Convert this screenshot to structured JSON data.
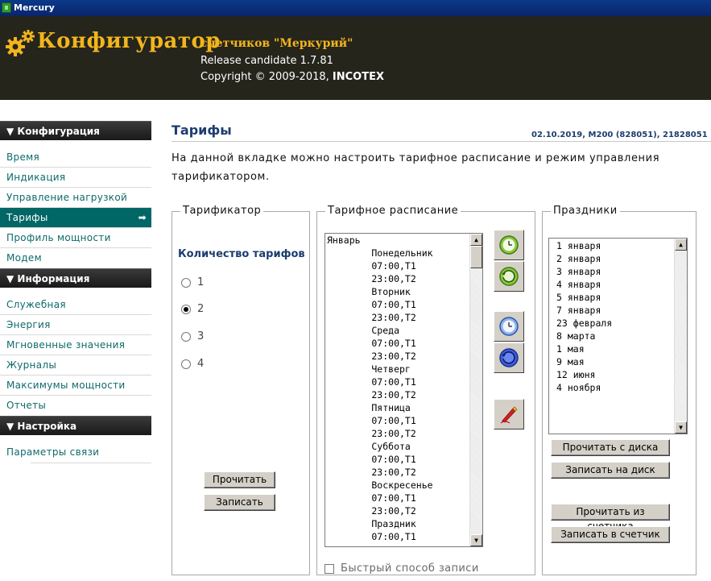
{
  "window": {
    "title": "Mercury"
  },
  "header": {
    "app_title": "Конфигуратор",
    "subtitle": "счетчиков \"Меркурий\"",
    "release": "Release candidate 1.7.81",
    "copyright_prefix": "Copyright © 2009-2018,",
    "copyright_company": "INCOTEX"
  },
  "sidebar": {
    "sections": [
      {
        "title": "▼ Конфигурация",
        "items": [
          "Время",
          "Индикация",
          "Управление нагрузкой",
          "Тарифы",
          "Профиль мощности",
          "Модем"
        ]
      },
      {
        "title": "▼ Информация",
        "items": [
          "Служебная",
          "Энергия",
          "Мгновенные значения",
          "Журналы",
          "Максимумы мощности",
          "Отчеты"
        ]
      },
      {
        "title": "▼ Настройка",
        "items": [
          "Параметры связи"
        ]
      }
    ],
    "active_item": "Тарифы",
    "active_arrow": "➡"
  },
  "main": {
    "title": "Тарифы",
    "info": "02.10.2019, M200 (828051), 21828051",
    "description": "На данной вкладке можно настроить тарифное расписание и режим управления тарификатором."
  },
  "tarifikator": {
    "title": "Тарификатор",
    "count_label": "Количество тарифов",
    "options": [
      "1",
      "2",
      "3",
      "4"
    ],
    "selected": "2",
    "read_button": "Прочитать",
    "write_button": "Записать"
  },
  "schedule": {
    "title": "Тарифное расписание",
    "lines": [
      "Январь",
      "        Понедельник",
      "        07:00,T1",
      "        23:00,T2",
      "        Вторник",
      "        07:00,T1",
      "        23:00,T2",
      "        Среда",
      "        07:00,T1",
      "        23:00,T2",
      "        Четверг",
      "        07:00,T1",
      "        23:00,T2",
      "        Пятница",
      "        07:00,T1",
      "        23:00,T2",
      "        Суббота",
      "        07:00,T1",
      "        23:00,T2",
      "        Воскресенье",
      "        07:00,T1",
      "        23:00,T2",
      "        Праздник",
      "        07:00,T1"
    ],
    "fast_write_label": "Быстрый способ записи",
    "fast_write_checked": false
  },
  "holidays": {
    "title": "Праздники",
    "items": [
      "1 января",
      "2 января",
      "3 января",
      "4 января",
      "5 января",
      "7 января",
      "23 февраля",
      "8 марта",
      "1 мая",
      "9 мая",
      "12 июня",
      "4 ноября"
    ],
    "read_disk": "Прочитать с диска",
    "write_disk": "Записать на диск",
    "read_meter": "Прочитать из счетчика",
    "write_meter": "Записать в счетчик"
  },
  "colors": {
    "header_bg": "#25251c",
    "brand": "#f2b51c",
    "active_nav": "#006666",
    "link": "#0f6a6a",
    "heading": "#1d3c6e"
  }
}
